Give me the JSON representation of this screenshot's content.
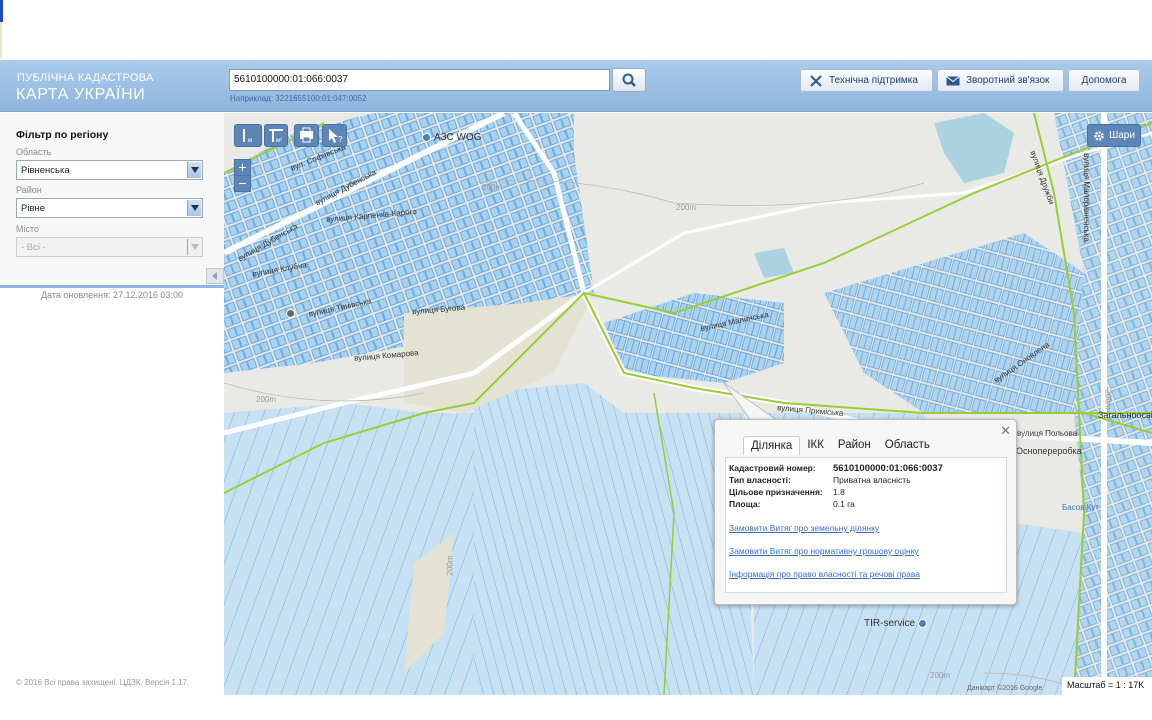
{
  "header": {
    "logo_line1": "ПУБЛІЧНА КАДАСТРОВА",
    "logo_line2": "КАРТА УКРАЇНИ",
    "search_value": "5610100000:01:066:0037",
    "search_hint": "Наприклад: 3221655100:01:047:0052",
    "buttons": {
      "support": "Технічна підтримка",
      "feedback": "Зворотний зв'язок",
      "help": "Допомога"
    },
    "icons": {
      "search": "search-icon",
      "support": "tools-icon",
      "feedback": "envelope-icon"
    }
  },
  "sidebar": {
    "filter_title": "Фільтр по регіону",
    "oblast_label": "Область",
    "oblast_value": "Рівненська",
    "raion_label": "Район",
    "raion_value": "Рівне",
    "city_label": "Місто",
    "city_value": "- Всі -",
    "updated": "Дата оновлення: 27.12.2016 03:00",
    "copyright": "© 2016 Всі права захищені. ЦДЗК. Версія 1.17."
  },
  "map": {
    "layers_label": "Шари",
    "attribution": "Данікарт ©2016 Google",
    "scale": "Масштаб = 1 : 17K",
    "streets": [
      "вул. Софіївська",
      "вулиця Дубенська",
      "вулиця Дубенська",
      "вулиця Карпенка-Карого",
      "вулиця Клубна",
      "вулиця Тинівська",
      "вулиця Бугова",
      "вулиця Комарова",
      "вулиця Малинська",
      "вулиця Приміська",
      "вулиця Польова",
      "вулиця Малорівненська",
      "вулиця Оновлена",
      "вулиця Дружби"
    ],
    "contours": [
      "200m",
      "200m",
      "200m",
      "200m",
      "200m",
      "200m"
    ],
    "pois": [
      "АЗС WOG",
      "TIR-service",
      "Басов Кут"
    ],
    "place_labels": [
      "Загальноосвітня",
      "Оснопереробка"
    ]
  },
  "popup": {
    "tabs": [
      "Ділянка",
      "ІКК",
      "Район",
      "Область"
    ],
    "active_tab": "Ділянка",
    "fields": [
      {
        "key": "Кадастровий номер:",
        "value": "5610100000:01:066:0037"
      },
      {
        "key": "Тип власності:",
        "value": "Приватна власність"
      },
      {
        "key": "Цільове призначення:",
        "value": "1.8"
      },
      {
        "key": "Площа:",
        "value": "0.1 га"
      }
    ],
    "links": [
      "Замовити Витяг про земельну ділянку",
      "Замовити Витяг про нормативну грошову оцінку",
      "Інформація про право власності та речові права"
    ]
  },
  "colors": {
    "header": "#8fb6de",
    "parcel_fill": "#b4d8f5",
    "parcel_stroke": "#5fa2d8",
    "boundary": "#9acd32",
    "water": "#aad3df"
  }
}
